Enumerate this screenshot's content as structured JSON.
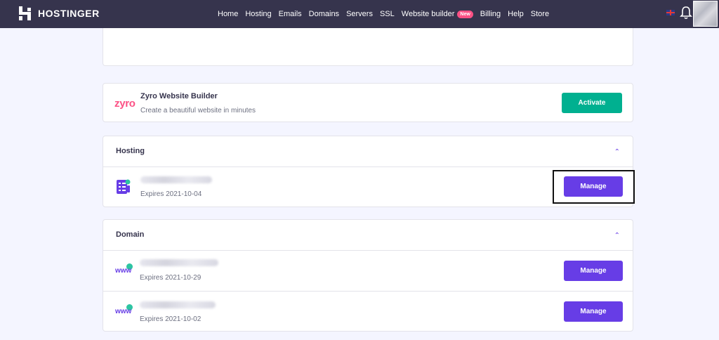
{
  "header": {
    "brand": "HOSTINGER",
    "nav": [
      {
        "label": "Home"
      },
      {
        "label": "Hosting"
      },
      {
        "label": "Emails"
      },
      {
        "label": "Domains"
      },
      {
        "label": "Servers"
      },
      {
        "label": "SSL"
      },
      {
        "label": "Website builder",
        "badge": "New"
      },
      {
        "label": "Billing"
      },
      {
        "label": "Help"
      },
      {
        "label": "Store"
      }
    ],
    "icons": [
      "uk-flag-icon",
      "bell-icon",
      "avatar"
    ]
  },
  "zyro": {
    "logo": "zyro",
    "title": "Zyro Website Builder",
    "subtitle": "Create a beautiful website in minutes",
    "button": "Activate"
  },
  "hosting": {
    "title": "Hosting",
    "items": [
      {
        "expires": "Expires 2021-10-04",
        "button": "Manage"
      }
    ]
  },
  "domain": {
    "title": "Domain",
    "items": [
      {
        "icon_text": "www",
        "expires": "Expires 2021-10-29",
        "button": "Manage"
      },
      {
        "icon_text": "www",
        "expires": "Expires 2021-10-02",
        "button": "Manage"
      }
    ]
  },
  "colors": {
    "topbar": "#36344d",
    "accent": "#673de6",
    "activate": "#00b090",
    "zyro": "#fc5185"
  }
}
